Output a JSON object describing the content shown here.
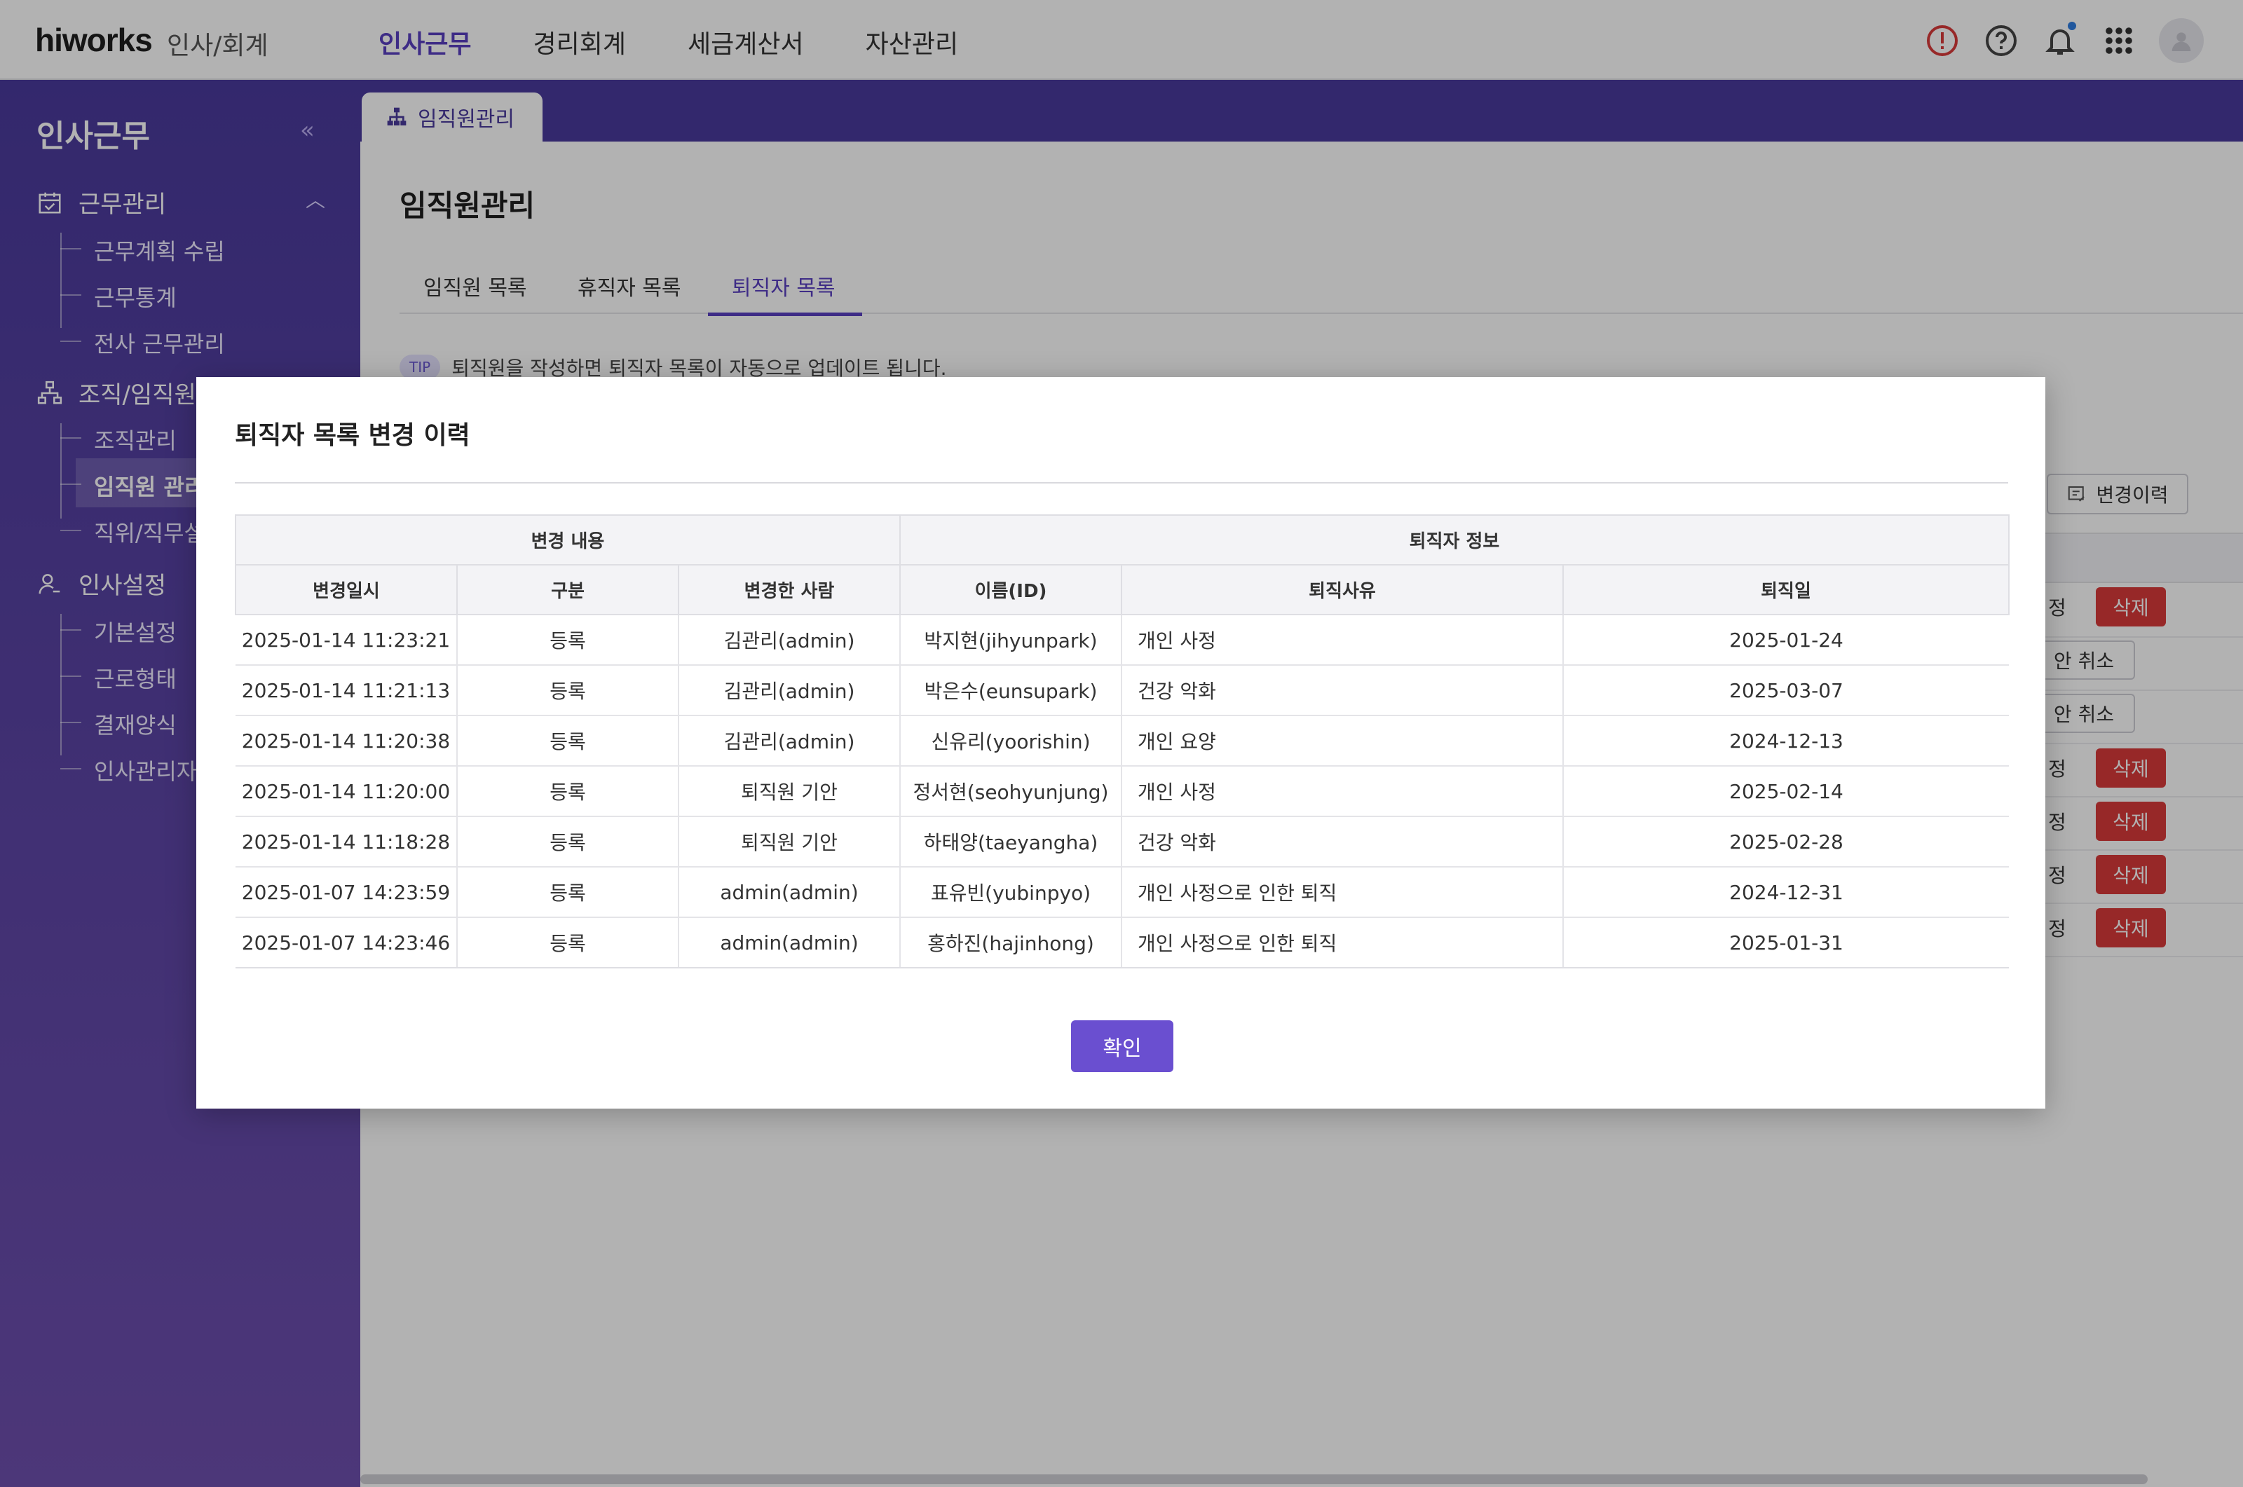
{
  "topbar": {
    "logo": "hiworks",
    "logo_sub": "인사/회계",
    "nav": [
      "인사근무",
      "경리회계",
      "세금계산서",
      "자산관리"
    ],
    "active_nav": "인사근무",
    "icons": [
      "alert-icon",
      "help-icon",
      "bell-icon",
      "apps-grid-icon",
      "avatar"
    ]
  },
  "sidebar": {
    "title": "인사근무",
    "groups": [
      {
        "label": "근무관리",
        "items": [
          "근무계획 수립",
          "근무통계",
          "전사 근무관리"
        ]
      },
      {
        "label": "조직/임직원관리",
        "items": [
          "조직관리",
          "임직원 관리",
          "직위/직무설정"
        ]
      },
      {
        "label": "인사설정",
        "items": [
          "기본설정",
          "근로형태",
          "결재양식",
          "인사관리자"
        ]
      }
    ]
  },
  "page": {
    "tab_label": "임직원관리",
    "title": "임직원관리",
    "subtabs": [
      "임직원 목록",
      "휴직자 목록",
      "퇴직자 목록"
    ],
    "active_subtab": "퇴직자 목록",
    "tip_badge": "TIP",
    "tip_text": "퇴직원을 작성하면 퇴직자 목록이 자동으로 업데이트 됩니다.",
    "history_button": "변경이력",
    "bg_fragments": {
      "edit_frag": "정",
      "delete": "삭제",
      "cancel": "안 취소"
    }
  },
  "modal": {
    "title": "퇴직자 목록 변경 이력",
    "group_headers": [
      "변경 내용",
      "퇴직자 정보"
    ],
    "columns": [
      "변경일시",
      "구분",
      "변경한 사람",
      "이름(ID)",
      "퇴직사유",
      "퇴직일"
    ],
    "rows": [
      [
        "2025-01-14 11:23:21",
        "등록",
        "김관리(admin)",
        "박지현(jihyunpark)",
        "개인 사정",
        "2025-01-24"
      ],
      [
        "2025-01-14 11:21:13",
        "등록",
        "김관리(admin)",
        "박은수(eunsupark)",
        "건강 악화",
        "2025-03-07"
      ],
      [
        "2025-01-14 11:20:38",
        "등록",
        "김관리(admin)",
        "신유리(yoorishin)",
        "개인 요양",
        "2024-12-13"
      ],
      [
        "2025-01-14 11:20:00",
        "등록",
        "퇴직원 기안",
        "정서현(seohyunjung)",
        "개인 사정",
        "2025-02-14"
      ],
      [
        "2025-01-14 11:18:28",
        "등록",
        "퇴직원 기안",
        "하태양(taeyangha)",
        "건강 악화",
        "2025-02-28"
      ],
      [
        "2025-01-07 14:23:59",
        "등록",
        "admin(admin)",
        "표유빈(yubinpyo)",
        "개인 사정으로 인한 퇴직",
        "2024-12-31"
      ],
      [
        "2025-01-07 14:23:46",
        "등록",
        "admin(admin)",
        "홍하진(hajinhong)",
        "개인 사정으로 인한 퇴직",
        "2025-01-31"
      ]
    ],
    "confirm_label": "확인"
  },
  "colors": {
    "brand_purple": "#4a3a9c",
    "accent": "#6a4fd0",
    "danger": "#d93a3a"
  }
}
